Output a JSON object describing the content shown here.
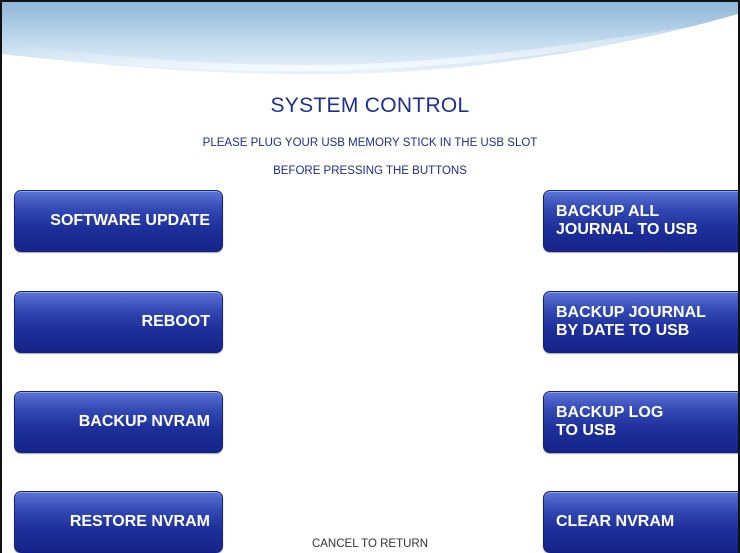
{
  "screen": {
    "title": "SYSTEM CONTROL",
    "instruction_line1": "PLEASE PLUG YOUR USB MEMORY STICK IN THE USB SLOT",
    "instruction_line2": "BEFORE PRESSING THE BUTTONS",
    "footer": "CANCEL TO RETURN"
  },
  "left_buttons": [
    {
      "label": "SOFTWARE UPDATE"
    },
    {
      "label": "REBOOT"
    },
    {
      "label": "BACKUP NVRAM"
    },
    {
      "label": "RESTORE NVRAM"
    }
  ],
  "right_buttons": [
    {
      "label": "BACKUP ALL\nJOURNAL TO USB"
    },
    {
      "label": "BACKUP JOURNAL\nBY DATE TO USB"
    },
    {
      "label": "BACKUP LOG\nTO USB"
    },
    {
      "label": "CLEAR NVRAM"
    }
  ],
  "colors": {
    "title_text": "#1d2f8c",
    "button_top": "#5a74d6",
    "button_bottom": "#16248a",
    "header_wave": "#bcd6ea"
  }
}
